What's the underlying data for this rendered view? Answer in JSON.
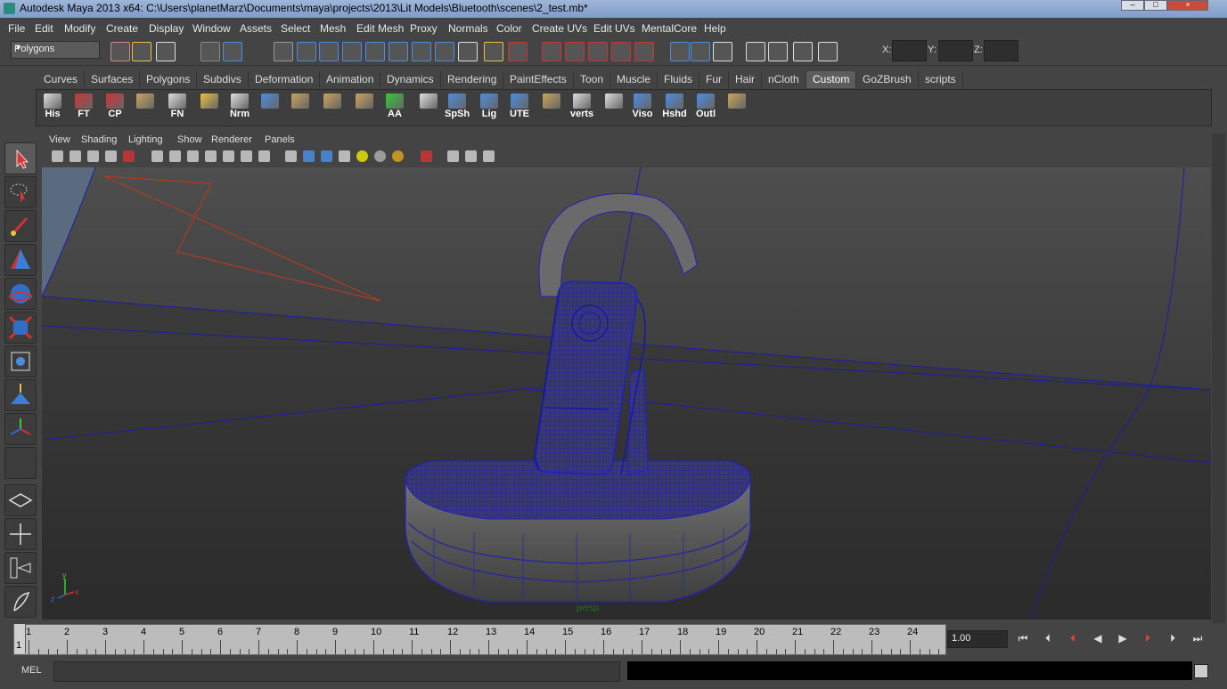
{
  "window": {
    "title": "Autodesk Maya 2013 x64: C:\\Users\\planetMarz\\Documents\\maya\\projects\\2013\\Lit Models\\Bluetooth\\scenes\\2_test.mb*"
  },
  "menubar": {
    "items": [
      "File",
      "Edit",
      "Modify",
      "Create",
      "Display",
      "Window",
      "Assets",
      "Select",
      "Mesh",
      "Edit Mesh",
      "Proxy",
      "Normals",
      "Color",
      "Create UVs",
      "Edit UVs",
      "MentalCore",
      "Help"
    ]
  },
  "toolbar": {
    "mode": "Polygons",
    "x_label": "X:",
    "y_label": "Y:",
    "z_label": "Z:",
    "x_value": "",
    "y_value": "",
    "z_value": ""
  },
  "shelf": {
    "tabs": [
      "Curves",
      "Surfaces",
      "Polygons",
      "Subdivs",
      "Deformation",
      "Animation",
      "Dynamics",
      "Rendering",
      "PaintEffects",
      "Toon",
      "Muscle",
      "Fluids",
      "Fur",
      "Hair",
      "nCloth",
      "Custom",
      "GoZBrush",
      "scripts"
    ],
    "active_tab": "Custom",
    "buttons": [
      {
        "label": "His"
      },
      {
        "label": "FT"
      },
      {
        "label": "CP"
      },
      {
        "label": ""
      },
      {
        "label": "FN"
      },
      {
        "label": ""
      },
      {
        "label": "Nrm"
      },
      {
        "label": ""
      },
      {
        "label": ""
      },
      {
        "label": ""
      },
      {
        "label": ""
      },
      {
        "label": "AA"
      },
      {
        "label": ""
      },
      {
        "label": "SpSh"
      },
      {
        "label": "Lig"
      },
      {
        "label": "UTE"
      },
      {
        "label": ""
      },
      {
        "label": "verts"
      },
      {
        "label": ""
      },
      {
        "label": "Viso"
      },
      {
        "label": "Hshd"
      },
      {
        "label": "Outl"
      },
      {
        "label": ""
      }
    ]
  },
  "viewport": {
    "menu": [
      "View",
      "Shading",
      "Lighting",
      "Show",
      "Renderer",
      "Panels"
    ],
    "camera_label": "persp",
    "axis_labels": {
      "x": "x",
      "y": "y",
      "z": "z"
    }
  },
  "timeline": {
    "ticks": [
      "1",
      "2",
      "3",
      "4",
      "5",
      "6",
      "7",
      "8",
      "9",
      "10",
      "11",
      "12",
      "13",
      "14",
      "15",
      "16",
      "17",
      "18",
      "19",
      "20",
      "21",
      "22",
      "23",
      "24"
    ],
    "current_frame": "1",
    "current_time": "1.00"
  },
  "command_line": {
    "label": "MEL",
    "input": ""
  },
  "colors": {
    "wireframe": "#2020c0",
    "accent_tab": "#5d5d5d"
  }
}
